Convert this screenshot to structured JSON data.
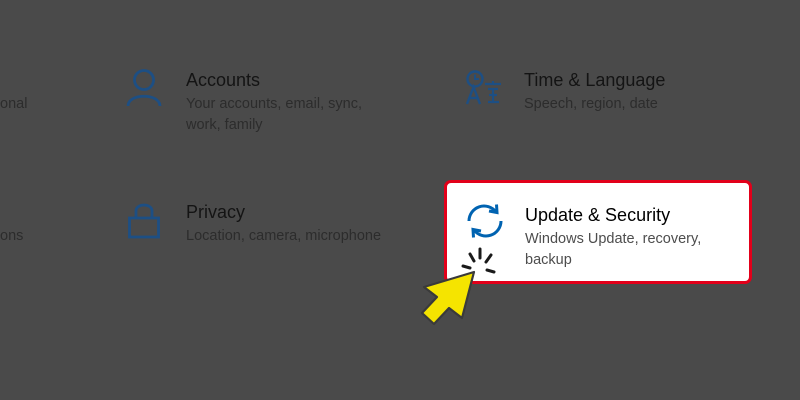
{
  "left_cut_texts": [
    "onal",
    "ons"
  ],
  "tiles": {
    "accounts": {
      "icon": "person-icon",
      "title": "Accounts",
      "description": "Your accounts, email, sync, work, family"
    },
    "time_language": {
      "icon": "time-language-icon",
      "title": "Time & Language",
      "description": "Speech, region, date"
    },
    "privacy": {
      "icon": "lock-icon",
      "title": "Privacy",
      "description": "Location, camera, microphone"
    },
    "update_security": {
      "icon": "sync-icon",
      "title": "Update & Security",
      "description": "Windows Update, recovery, backup"
    }
  },
  "overlay": {
    "highlight_color": "#e2001a",
    "pointer_color": "#f5e400",
    "pointer_icon": "click-cursor-icon"
  }
}
